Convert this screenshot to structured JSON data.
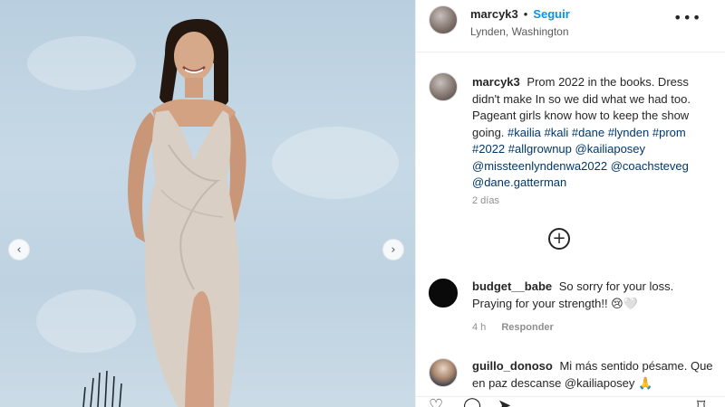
{
  "post": {
    "username": "marcyk3",
    "separator": "•",
    "follow_label": "Seguir",
    "location": "Lynden, Washington",
    "more_icon": "more-options-icon"
  },
  "caption": {
    "username": "marcyk3",
    "text": "Prom 2022 in the books. Dress didn't make In so we did what we had too. Pageant girls know how to keep the show going.",
    "tags": [
      "#kailia",
      "#kali",
      "#dane",
      "#lynden",
      "#prom",
      "#2022",
      "#allgrownup",
      "@kailiaposey",
      "@missteenlyndenwa2022",
      "@coachsteveg",
      "@dane.gatterman"
    ],
    "time_ago": "2 días"
  },
  "load_more_icon": "plus-circle-icon",
  "comments": [
    {
      "username": "budget__babe",
      "text": "So sorry for your loss. Praying for your strength!! 😢🤍",
      "time": "4 h",
      "reply_label": "Responder"
    },
    {
      "username": "guillo_donoso",
      "text": "Mi más sentido pésame. Que en paz descanse @kailiaposey 🙏"
    }
  ],
  "carousel": {
    "prev_icon": "chevron-left-icon",
    "next_icon": "chevron-right-icon"
  },
  "actions": [
    "heart-icon",
    "comment-icon",
    "share-icon",
    "bookmark-icon"
  ]
}
